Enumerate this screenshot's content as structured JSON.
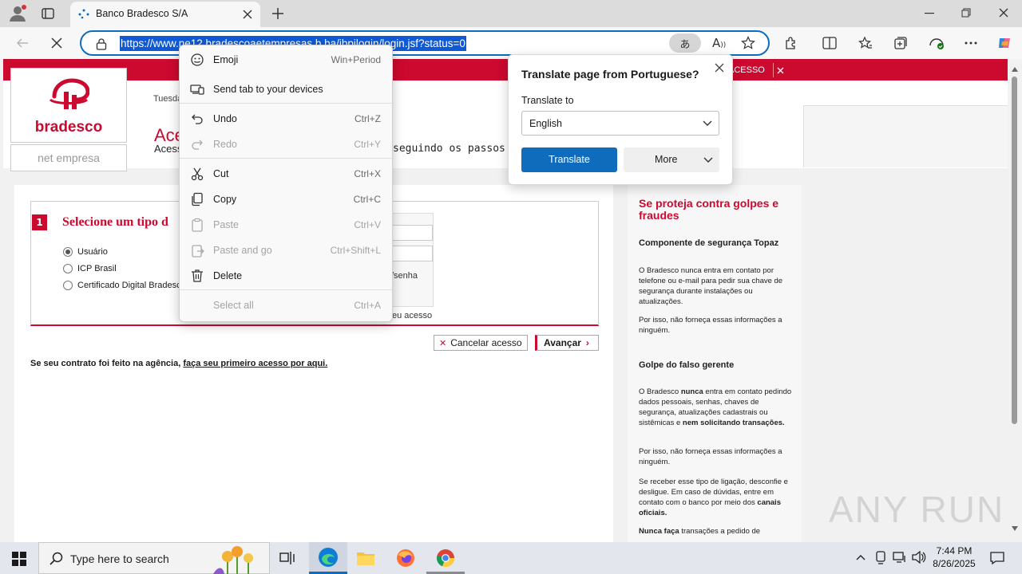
{
  "browser": {
    "tab_title": "Banco Bradesco S/A",
    "url": "https://www.ne12.bradescoaetempresas.b.ba/ibpjlogin/login.jsf?status=0",
    "colors": {
      "accent": "#0f6cbd",
      "selection": "#0f5ad4"
    }
  },
  "page": {
    "logo_text": "bradesco",
    "net_empresa": "net empresa",
    "date_partial": "Tuesda",
    "heading_partial": "Ace",
    "subheading_partial": "Acess",
    "steps_text": "seguindo os passos abaix",
    "top_button_partial": "ACESSO",
    "form": {
      "step_number": "1",
      "step_title": "Selecione um tipo d",
      "options": [
        "Usuário",
        "ICP Brasil",
        "Certificado Digital Bradesco"
      ],
      "selected": "Usuário",
      "senha_partial": "/senha",
      "acesso_partial": "eu acesso"
    },
    "cancel_button": "Cancelar acesso",
    "next_button": "Avançar",
    "agency_text": "Se seu contrato foi feito na agência, ",
    "agency_link": "faça seu primeiro acesso por aqui.",
    "brand_red": "#cc092f",
    "sidebar": {
      "title": "Se proteja contra golpes e fraudes",
      "topaz_title": "Componente de segurança Topaz",
      "topaz_p1": "O Bradesco nunca entra em contato por telefone ou e-mail para pedir sua chave de segurança durante instalações ou atualizações.",
      "topaz_p2": "Por isso, não forneça essas informações a ninguém.",
      "gerente_title": "Golpe do falso gerente",
      "gerente_p1_a": "O Bradesco ",
      "gerente_p1_b": "nunca",
      "gerente_p1_c": " entra em contato pedindo dados pessoais, senhas, chaves de segurança, atualizações cadastrais ou sistêmicas e ",
      "gerente_p1_d": "nem solicitando transações.",
      "gerente_p2": "Por isso, não forneça essas informações a ninguém.",
      "gerente_p3_a": "Se receber esse tipo de ligação, desconfie e desligue. Em caso de dúvidas, entre em contato com o banco por meio dos ",
      "gerente_p3_b": "canais oficiais.",
      "gerente_p4_a": "Nunca faça",
      "gerente_p4_b": " transações a pedido de"
    }
  },
  "context_menu": {
    "items": [
      {
        "label": "Emoji",
        "shortcut": "Win+Period",
        "icon": "emoji-icon"
      },
      {
        "label": "Send tab to your devices",
        "shortcut": "",
        "icon": "send-tab-icon"
      },
      {
        "label": "Undo",
        "shortcut": "Ctrl+Z",
        "icon": "undo-icon"
      },
      {
        "label": "Redo",
        "shortcut": "Ctrl+Y",
        "icon": "redo-icon"
      },
      {
        "label": "Cut",
        "shortcut": "Ctrl+X",
        "icon": "cut-icon"
      },
      {
        "label": "Copy",
        "shortcut": "Ctrl+C",
        "icon": "copy-icon"
      },
      {
        "label": "Paste",
        "shortcut": "Ctrl+V",
        "icon": "paste-icon"
      },
      {
        "label": "Paste and go",
        "shortcut": "Ctrl+Shift+L",
        "icon": "paste-go-icon"
      },
      {
        "label": "Delete",
        "shortcut": "",
        "icon": "delete-icon"
      },
      {
        "label": "Select all",
        "shortcut": "Ctrl+A",
        "icon": ""
      }
    ]
  },
  "translate": {
    "title": "Translate page from Portuguese?",
    "label": "Translate to",
    "language": "English",
    "translate_button": "Translate",
    "more_button": "More"
  },
  "taskbar": {
    "search_placeholder": "Type here to search",
    "time": "7:44 PM",
    "date": "8/26/2025"
  },
  "watermark": "ANY RUN"
}
